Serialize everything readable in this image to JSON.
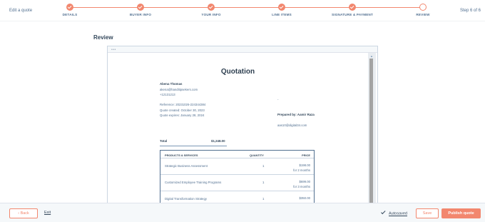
{
  "header": {
    "title": "Edit a quote",
    "step_count": "Step 6 of 6",
    "steps": [
      {
        "label": "DETAILS",
        "state": "complete"
      },
      {
        "label": "BUYER INFO",
        "state": "complete"
      },
      {
        "label": "YOUR INFO",
        "state": "complete"
      },
      {
        "label": "LINE ITEMS",
        "state": "complete"
      },
      {
        "label": "SIGNATURE & PAYMENT",
        "state": "complete"
      },
      {
        "label": "REVIEW",
        "state": "current"
      }
    ]
  },
  "main": {
    "section_title": "Review",
    "frame_dots": "•••"
  },
  "quote": {
    "title": "Quotation",
    "buyer_name": "Abena Thomas",
    "buyer_email": "akena@handitipsekers.com",
    "buyer_phone": "+12131213",
    "reference": "Reference: 20231026-224344384",
    "created": "Quote created: October 30, 2023",
    "expires": "Quote expires: January 28, 2024",
    "separator": "-",
    "prepared_by": "Prepared by: Aamir Raza",
    "seller_email": "aas10@digital34.com",
    "total_label": "Total",
    "total_value": "$1,248.00",
    "columns": [
      "PRODUCTS & SERVICES",
      "QUANTITY",
      "PRICE"
    ],
    "items": [
      {
        "name": "Strategic Business Assessment",
        "quantity": "1",
        "price": "$198.00",
        "term": "for 2 months"
      },
      {
        "name": "Customized Employee Training Programs",
        "quantity": "1",
        "price": "$699.00",
        "term": "for 3 months"
      },
      {
        "name": "Digital Transformation Strategy",
        "quantity": "1",
        "price": "$350.00",
        "term": ""
      }
    ]
  },
  "footer": {
    "back_label": "Back",
    "back_icon": "chevron-left-icon",
    "exit_label": "Exit",
    "autosaved_label": "Autosaved",
    "save_label": "Save",
    "publish_label": "Publish quote"
  },
  "colors": {
    "accent": "#f2876e",
    "text": "#33475b",
    "muted": "#516f90"
  }
}
